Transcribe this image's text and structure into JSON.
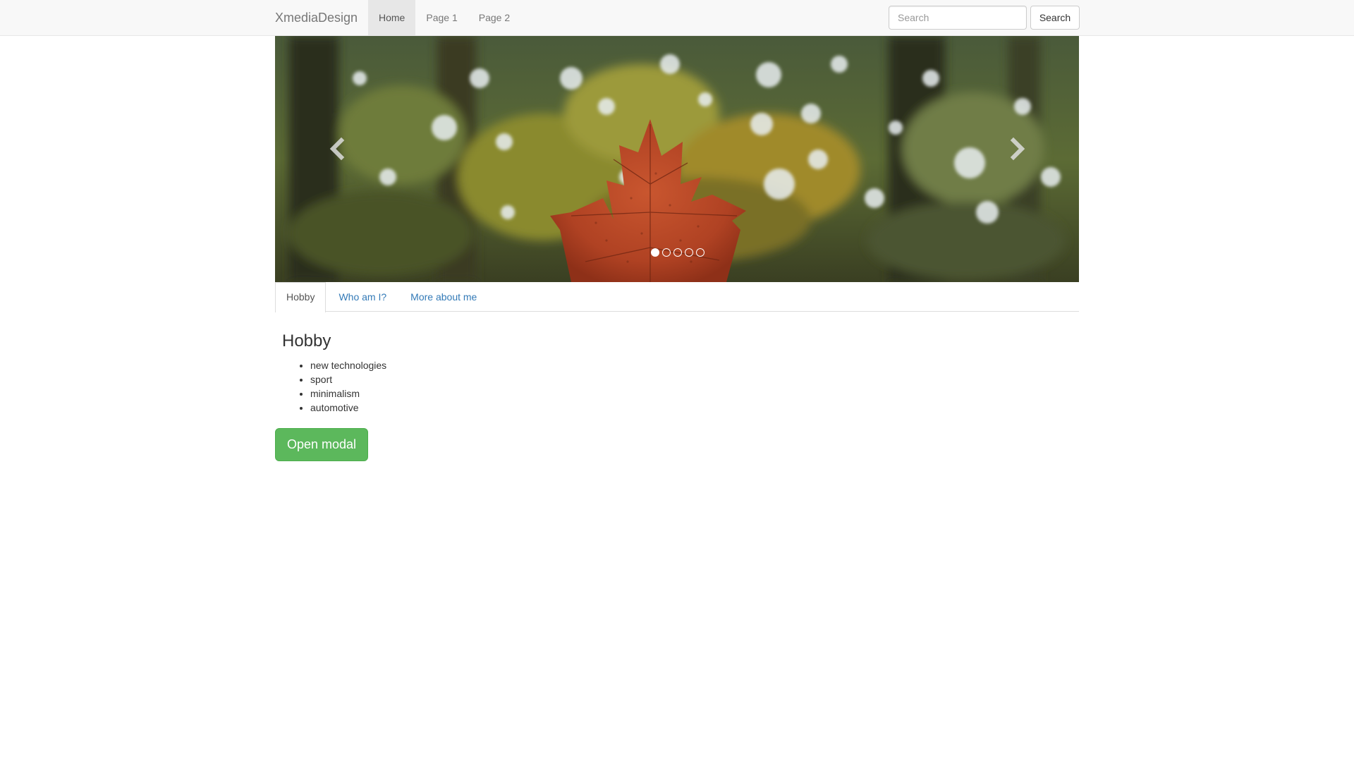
{
  "navbar": {
    "brand": "XmediaDesign",
    "links": [
      {
        "label": "Home",
        "active": true
      },
      {
        "label": "Page 1",
        "active": false
      },
      {
        "label": "Page 2",
        "active": false
      }
    ],
    "search": {
      "placeholder": "Search",
      "value": "",
      "button_label": "Search"
    }
  },
  "carousel": {
    "image": "autumn maple leaf in forest",
    "slide_count": 5,
    "active_slide": 1,
    "prev_icon": "chevron-left-icon",
    "next_icon": "chevron-right-icon"
  },
  "tabs": [
    {
      "label": "Hobby",
      "active": true
    },
    {
      "label": "Who am I?",
      "active": false
    },
    {
      "label": "More about me",
      "active": false
    }
  ],
  "content": {
    "title": "Hobby",
    "items": [
      "new technologies",
      "sport",
      "minimalism",
      "automotive"
    ]
  },
  "modal_button": {
    "label": "Open modal"
  },
  "colors": {
    "navbar_bg": "#f8f8f8",
    "link": "#337ab7",
    "success": "#5cb85c",
    "leaf": "#b5442a"
  }
}
